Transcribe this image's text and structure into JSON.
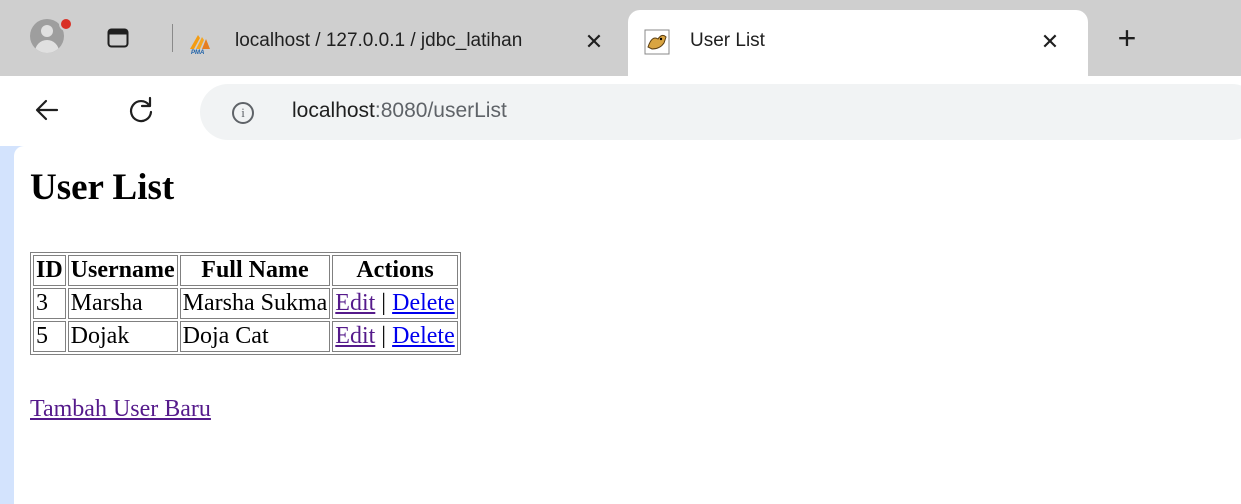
{
  "tabs": [
    {
      "title": "localhost / 127.0.0.1 / jdbc_latihan",
      "icon": "phpmyadmin-icon",
      "close": "✕",
      "active": false
    },
    {
      "title": "User List",
      "icon": "tomcat-icon",
      "close": "✕",
      "active": true
    }
  ],
  "new_tab": "+",
  "address": {
    "host": "localhost",
    "rest": ":8080/userList",
    "info": "i"
  },
  "page": {
    "heading": "User List",
    "table": {
      "headers": [
        "ID",
        "Username",
        "Full Name",
        "Actions"
      ],
      "rows": [
        {
          "id": "3",
          "username": "Marsha",
          "full_name": "Marsha Sukma",
          "edit": "Edit",
          "sep": "|",
          "delete": "Delete"
        },
        {
          "id": "5",
          "username": "Dojak",
          "full_name": "Doja Cat",
          "edit": "Edit",
          "sep": "|",
          "delete": "Delete"
        }
      ]
    },
    "add_link": "Tambah User Baru"
  },
  "colors": {
    "link": "#0000ee",
    "visited_link": "#551a8b",
    "tabstrip": "#cfcfcf"
  }
}
